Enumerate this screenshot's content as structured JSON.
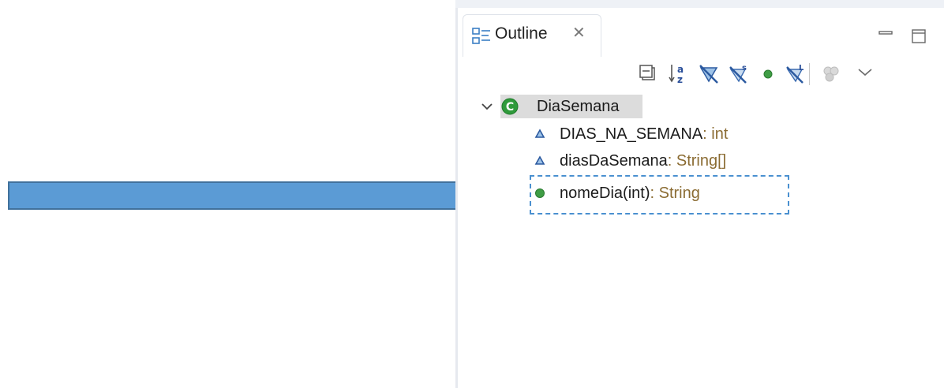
{
  "outline_tab": {
    "title": "Outline",
    "close_glyph": "✕",
    "icon": "outline-view-icon"
  },
  "window_buttons": {
    "minimize_icon": "minimize-icon",
    "maximize_icon": "maximize-icon"
  },
  "toolbar": {
    "buttons": [
      {
        "name": "collapse-all-icon"
      },
      {
        "name": "sort-alphabetical-icon"
      },
      {
        "name": "hide-fields-icon"
      },
      {
        "name": "hide-static-icon"
      },
      {
        "name": "public-method-filter-icon"
      },
      {
        "name": "hide-local-types-icon"
      },
      {
        "name": "link-with-editor-icon"
      },
      {
        "name": "view-menu-chevron-icon"
      }
    ]
  },
  "tree": {
    "class_node": {
      "label": "DiaSemana",
      "icon": "class-icon",
      "expanded": true
    },
    "members": [
      {
        "name": "DIAS_NA_SEMANA",
        "type": " : int",
        "icon": "field-icon"
      },
      {
        "name": "diasDaSemana",
        "type": " : String[]",
        "icon": "field-icon"
      },
      {
        "name": "nomeDia(int)",
        "type": " : String",
        "icon": "public-method-icon"
      }
    ]
  },
  "colors": {
    "arrow_fill": "#5b9bd5",
    "arrow_stroke": "#41719c",
    "class_icon": "#2f9a3b",
    "method_icon": "#3f9d45",
    "field_icon": "#2c5aa0",
    "type_suffix": "#8b6c33",
    "selection_border": "#4a90d0"
  }
}
